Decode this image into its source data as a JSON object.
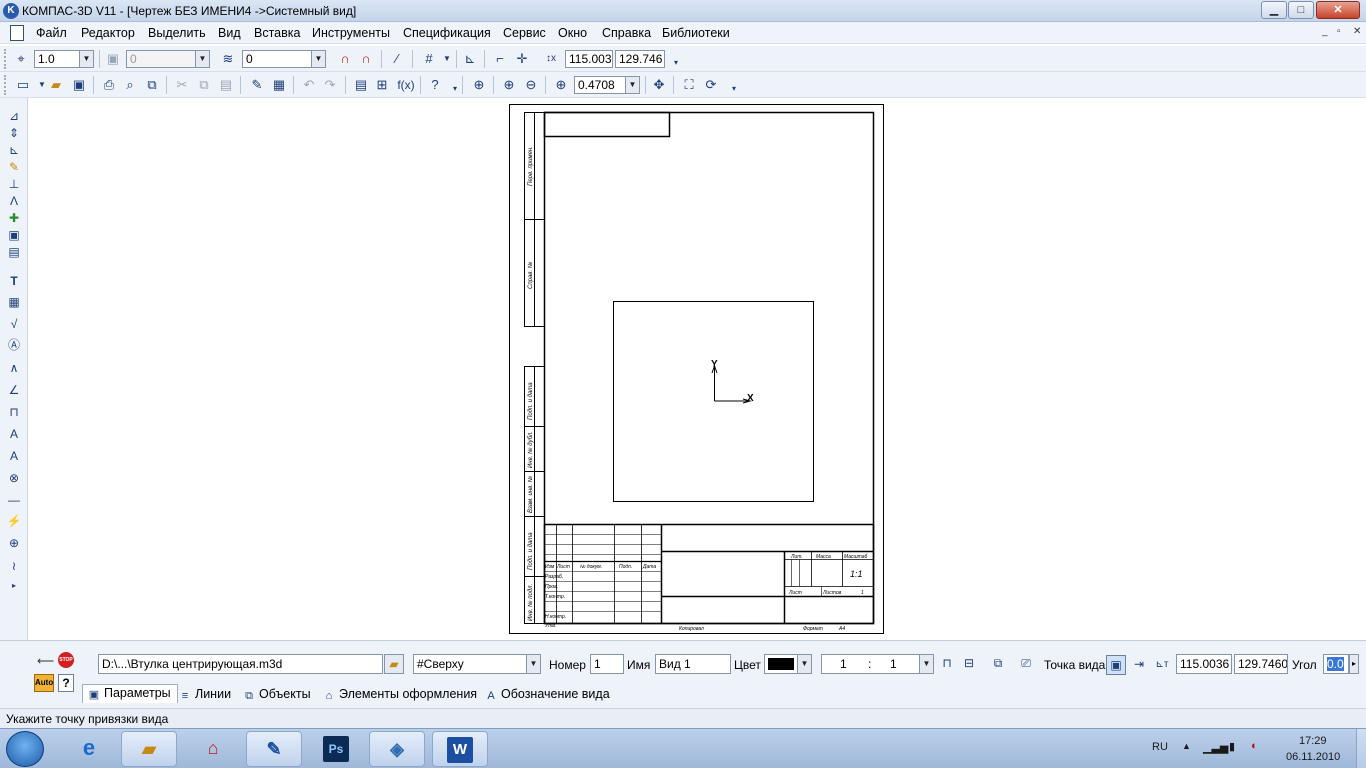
{
  "titlebar": {
    "app_logo": "K",
    "title": "КОМПАС-3D V11 - [Чертеж БЕЗ ИМЕНИ4 ->Системный вид]",
    "minimize": "▁",
    "maximize": "□",
    "close": "✕"
  },
  "menu": {
    "items": [
      "Файл",
      "Редактор",
      "Выделить",
      "Вид",
      "Вставка",
      "Инструменты",
      "Спецификация",
      "Сервис",
      "Окно",
      "Справка",
      "Библиотеки"
    ],
    "mdi_controls": [
      "_",
      "▫",
      "✕"
    ]
  },
  "toolbar1": {
    "line_weight": "1.0",
    "layer_state": "0",
    "layer": "0",
    "coord_x": "115.003",
    "coord_y": "129.746"
  },
  "toolbar2": {
    "zoom": "0.4708"
  },
  "drawing": {
    "side_labels": [
      "Перв. примен.",
      "Справ. №",
      "Подп. и дата",
      "Инв. № дубл.",
      "Взам. инв. №",
      "Подп. и дата",
      "Инв. № подл."
    ],
    "stamp_header": [
      "Изм",
      "Лист",
      "№ докум.",
      "Подп.",
      "Дата"
    ],
    "stamp_rows": [
      "Разраб.",
      "Пров.",
      "Т.контр.",
      "",
      "Н.контр.",
      "Утв."
    ],
    "stamp_cols": [
      "Лит.",
      "Масса",
      "Масштаб"
    ],
    "scale_value": "1:1",
    "sheet_label": "Лист",
    "sheets_label": "Листов",
    "sheets_value": "1",
    "copied": "Копировал",
    "format": "Формат",
    "format_value": "A4",
    "axis_x": "X",
    "axis_y": "Y"
  },
  "properties": {
    "file": "D:\\...\\Втулка центрирующая.m3d",
    "view_orientation": "#Сверху",
    "number_label": "Номер",
    "number_value": "1",
    "name_label": "Имя",
    "name_value": "Вид 1",
    "color_label": "Цвет",
    "color_value": "#000000",
    "scale_left": "1",
    "scale_sep": ":",
    "scale_right": "1",
    "anchor_label": "Точка вида",
    "anchor_x": "115.0036",
    "anchor_y": "129.7460",
    "angle_label": "Угол",
    "angle_value": "0.0",
    "auto": "Auto",
    "stop": "STOP",
    "tabs": [
      "Параметры",
      "Линии",
      "Объекты",
      "Элементы оформления",
      "Обозначение вида"
    ]
  },
  "status": {
    "text": "Укажите точку привязки вида"
  },
  "taskbar": {
    "apps": [
      "ie",
      "explorer",
      "acrobat",
      "kompas",
      "photoshop",
      "vmware",
      "word"
    ],
    "labels": {
      "photoshop": "Ps",
      "word": "W"
    },
    "lang": "RU",
    "time": "17:29",
    "date": "06.11.2010"
  }
}
